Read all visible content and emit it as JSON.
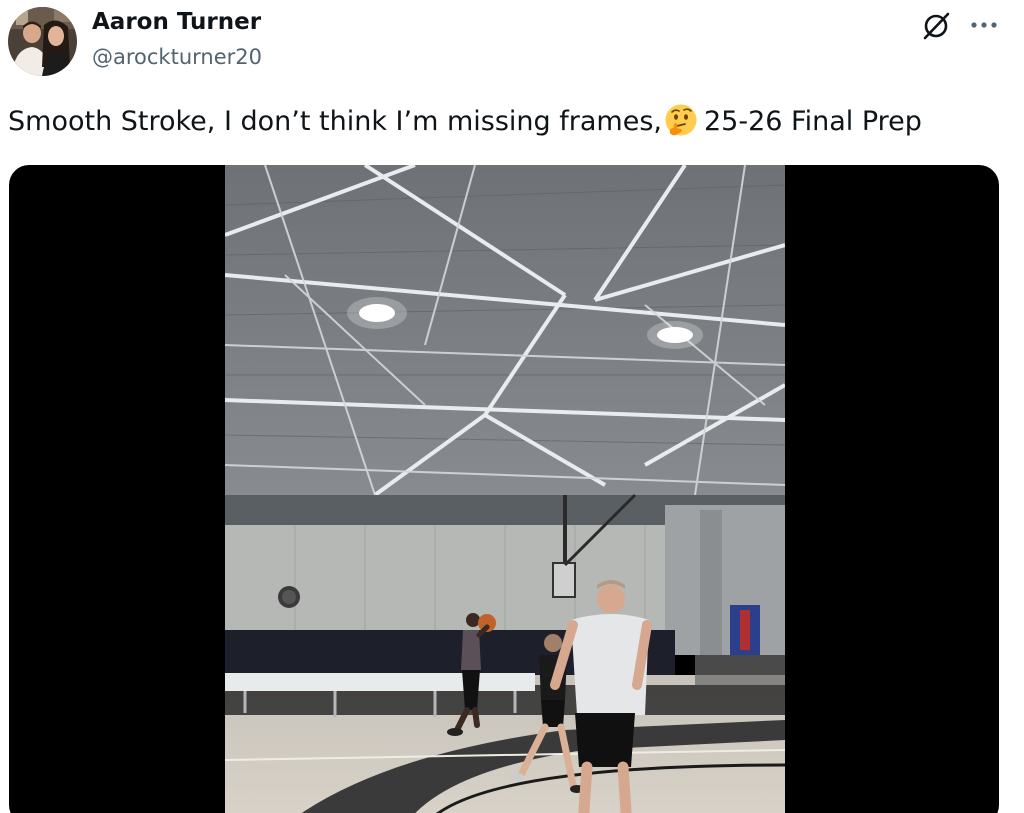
{
  "author": {
    "display_name": "Aaron Turner",
    "handle": "@arockturner20"
  },
  "tweet": {
    "text_before_emoji": "Smooth Stroke, I don’t think I’m missing frames,",
    "emoji": "thinking-face",
    "text_after_emoji": "25-26 Final Prep"
  },
  "media": {
    "type": "video",
    "scene": "indoor basketball gym, player shooting a jump shot"
  },
  "icons": {
    "grok": "grok-icon",
    "more": "more-options-icon"
  },
  "colors": {
    "name": "#0f1419",
    "handle": "#536471",
    "media_bg": "#000000"
  }
}
